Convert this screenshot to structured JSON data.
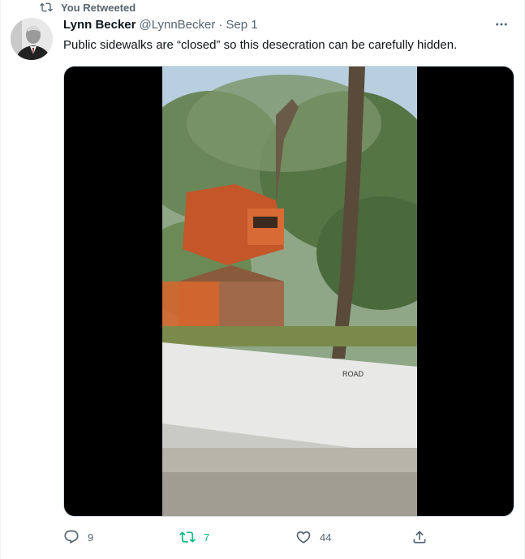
{
  "context": {
    "label": "You Retweeted",
    "icon": "retweet-icon"
  },
  "author": {
    "name": "Lynn Becker",
    "handle": "@LynnBecker",
    "separator": "·",
    "date": "Sep 1",
    "avatar_icon": "avatar"
  },
  "tweet": {
    "text": "Public sidewalks are “closed” so this desecration can be carefully hidden.",
    "more_icon": "more-icon"
  },
  "media": {
    "type": "video"
  },
  "actions": {
    "reply": {
      "icon": "reply-icon",
      "count": "9"
    },
    "retweet": {
      "icon": "retweet-icon",
      "count": "7",
      "active": true,
      "color": "#00ba7c"
    },
    "like": {
      "icon": "like-icon",
      "count": "44"
    },
    "share": {
      "icon": "share-icon"
    }
  },
  "colors": {
    "text": "#0f1419",
    "secondary": "#536471",
    "retweet_active": "#00ba7c",
    "border": "#cfd9de"
  }
}
